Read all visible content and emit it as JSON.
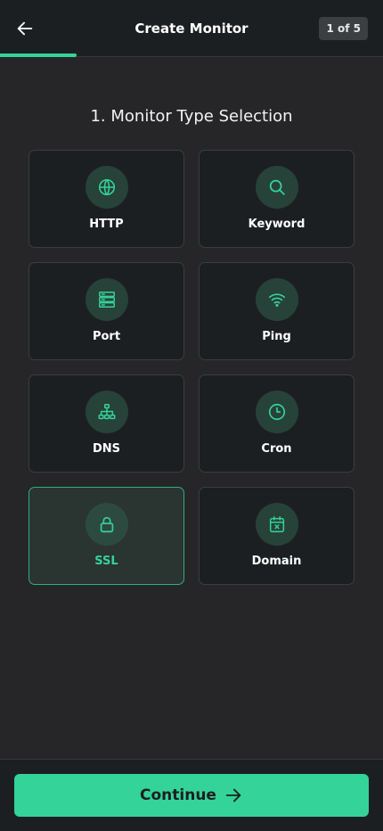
{
  "header": {
    "title": "Create Monitor",
    "step": "1 of 5",
    "progress_fraction": 0.2
  },
  "section": {
    "title": "1. Monitor Type Selection"
  },
  "monitor_types": [
    {
      "label": "HTTP",
      "icon": "globe-icon",
      "selected": false
    },
    {
      "label": "Keyword",
      "icon": "search-icon",
      "selected": false
    },
    {
      "label": "Port",
      "icon": "server-icon",
      "selected": false
    },
    {
      "label": "Ping",
      "icon": "wifi-icon",
      "selected": false
    },
    {
      "label": "DNS",
      "icon": "network-icon",
      "selected": false
    },
    {
      "label": "Cron",
      "icon": "clock-icon",
      "selected": false
    },
    {
      "label": "SSL",
      "icon": "lock-icon",
      "selected": true
    },
    {
      "label": "Domain",
      "icon": "calendar-x-icon",
      "selected": false
    }
  ],
  "footer": {
    "continue_label": "Continue"
  },
  "colors": {
    "accent": "#34d399",
    "background": "#262628",
    "card": "#1c1f21",
    "selected_card": "#2a3431"
  }
}
